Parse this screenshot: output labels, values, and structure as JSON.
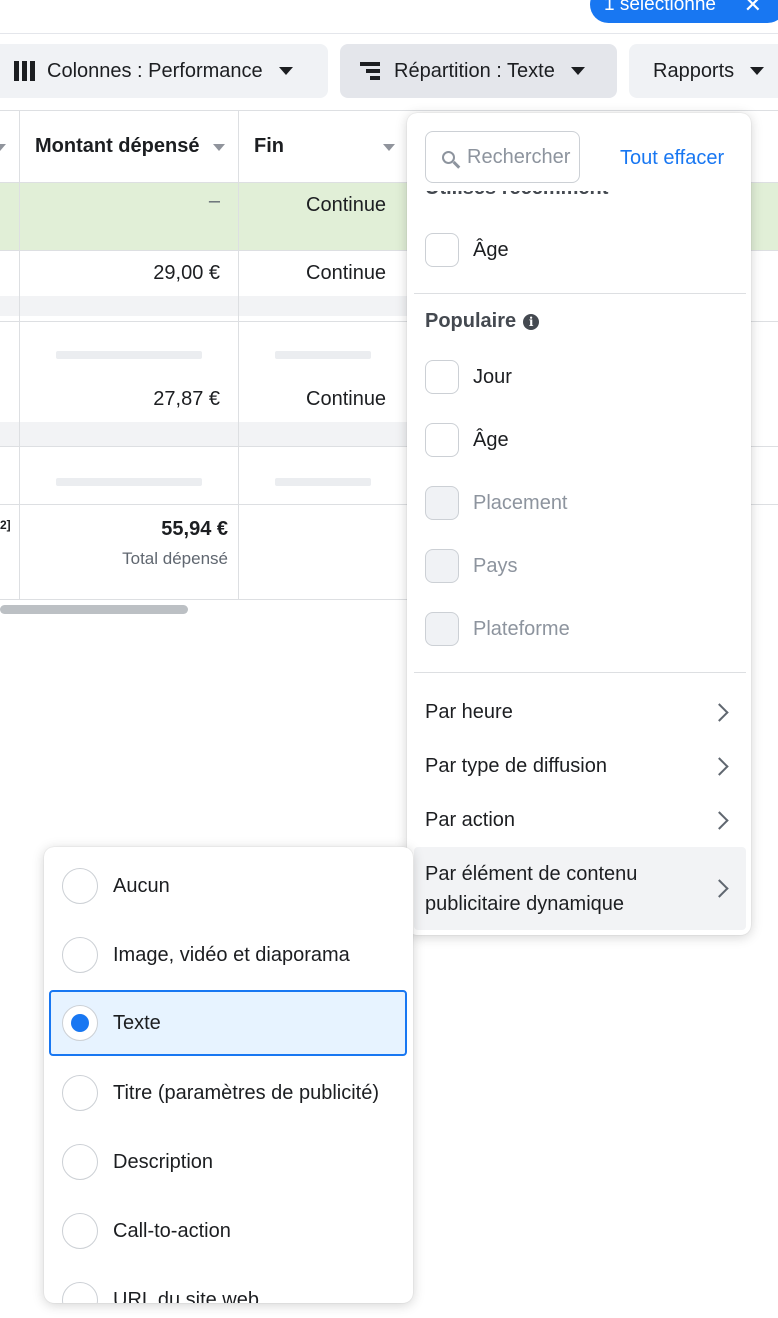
{
  "selection": {
    "label": "1 sélectionné",
    "close_icon": "close-icon"
  },
  "toolbar": {
    "columns_label": "Colonnes : Performance",
    "breakdown_label": "Répartition : Texte",
    "reports_label": "Rapports"
  },
  "table": {
    "headers": {
      "amount_spent": "Montant dépensé",
      "end": "Fin"
    },
    "rows": [
      {
        "amount": "–",
        "end": "Continue"
      },
      {
        "amount": "29,00 €",
        "end": "Continue"
      },
      {
        "amount": "27,87 €",
        "end": "Continue"
      }
    ],
    "footer_marker": "2]",
    "total": {
      "amount": "55,94 €",
      "label": "Total dépensé"
    }
  },
  "breakdown_menu": {
    "search_placeholder": "Rechercher",
    "clear_all": "Tout effacer",
    "recent_heading": "Utilisés récemment",
    "recent_items": [
      {
        "label": "Âge",
        "checked": false
      }
    ],
    "popular_heading": "Populaire",
    "popular_items": [
      {
        "label": "Jour",
        "checked": false,
        "disabled": false
      },
      {
        "label": "Âge",
        "checked": false,
        "disabled": false
      },
      {
        "label": "Placement",
        "checked": false,
        "disabled": true
      },
      {
        "label": "Pays",
        "checked": false,
        "disabled": true
      },
      {
        "label": "Plateforme",
        "checked": false,
        "disabled": true
      }
    ],
    "nav_items": [
      {
        "label": "Par heure"
      },
      {
        "label": "Par type de diffusion"
      },
      {
        "label": "Par action"
      },
      {
        "label_line1": "Par élément de contenu",
        "label_line2": "publicitaire dynamique",
        "hovered": true
      }
    ]
  },
  "dynamic_submenu": {
    "options": [
      {
        "label": "Aucun",
        "selected": false
      },
      {
        "label": "Image, vidéo et diaporama",
        "selected": false
      },
      {
        "label": "Texte",
        "selected": true
      },
      {
        "label": "Titre (paramètres de publicité)",
        "selected": false
      },
      {
        "label": "Description",
        "selected": false
      },
      {
        "label": "Call-to-action",
        "selected": false
      },
      {
        "label": "URL du site web",
        "selected": false
      }
    ]
  },
  "colors": {
    "accent": "#1877f2",
    "highlight_row": "#e1efd7",
    "selected_option_bg": "#e7f3ff"
  }
}
